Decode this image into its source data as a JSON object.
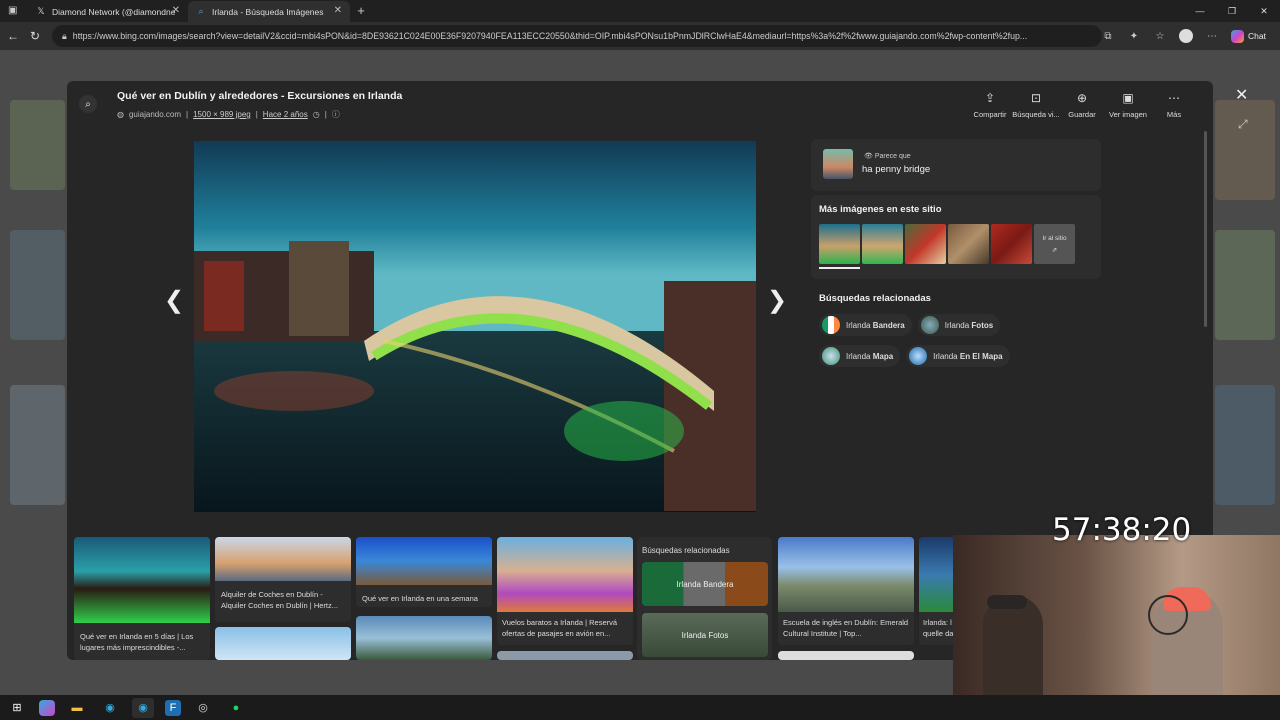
{
  "browser": {
    "tabs": [
      {
        "title": "Diamond Network (@diamondne",
        "icon": "x-logo-icon"
      },
      {
        "title": "Irlanda - Búsqueda Imágenes",
        "icon": "bing-search-icon"
      }
    ],
    "url": "https://www.bing.com/images/search?view=detailV2&ccid=mbi4sPON&id=8DE93621C024E00E36F9207940FEA113ECC20550&thid=OIP.mbi4sPONsu1bPnmJDlRClwHaE4&mediaurl=https%3a%2f%2fwww.guiajando.com%2fwp-content%2fup...",
    "chat_label": "Chat"
  },
  "modal": {
    "title": "Qué ver en Dublín y alrededores - Excursiones en Irlanda",
    "source": "guiajando.com",
    "dimensions": "1500 × 989 jpeg",
    "age": "Hace 2 años",
    "actions": [
      {
        "label": "Compartir",
        "icon": "share-icon"
      },
      {
        "label": "Búsqueda vi...",
        "icon": "visual-search-icon"
      },
      {
        "label": "Guardar",
        "icon": "save-icon"
      },
      {
        "label": "Ver imagen",
        "icon": "image-icon"
      },
      {
        "label": "Más",
        "icon": "more-icon"
      }
    ]
  },
  "sidebar": {
    "looks_like_label": "Parece que",
    "looks_like_value": "ha penny bridge",
    "more_images_title": "Más imágenes en este sitio",
    "go_to_site": "Ir al sitio",
    "related_title": "Búsquedas relacionadas",
    "related": [
      {
        "prefix": "Irlanda",
        "bold": "Bandera"
      },
      {
        "prefix": "Irlanda",
        "bold": "Fotos"
      },
      {
        "prefix": "Irlanda",
        "bold": "Mapa"
      },
      {
        "prefix": "Irlanda",
        "bold": "En El Mapa"
      }
    ]
  },
  "grid": {
    "captions": [
      "Qué ver en Irlanda en 5 días | Los lugares más imprescindibles -...",
      "Alquiler de Coches en Dublín - Alquiler Coches en Dublín | Hertz...",
      "Qué ver en Irlanda en una semana",
      "Vuelos baratos a Irlanda | Reservá ofertas de pasajes en avión en...",
      "Escuela de inglés en Dublín: Emerald Cultural Institute | Top...",
      "Irlanda: l quelle da"
    ],
    "related_title": "Búsquedas relacionadas",
    "related": [
      "Irlanda Bandera",
      "Irlanda Fotos"
    ]
  },
  "overlay": {
    "timer": "57:38:20"
  }
}
